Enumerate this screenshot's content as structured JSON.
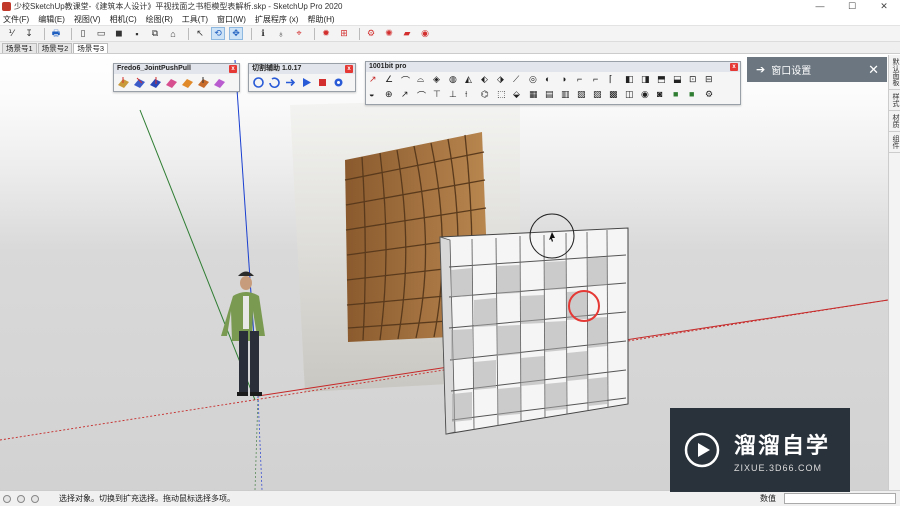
{
  "window": {
    "title": "少校SketchUp教课堂-《建筑本人设计》平视找面之书柜模型表解析.skp - SketchUp Pro 2020",
    "controls": [
      "—",
      "☐",
      "✕"
    ]
  },
  "menu": [
    "文件(F)",
    "编辑(E)",
    "视图(V)",
    "相机(C)",
    "绘图(R)",
    "工具(T)",
    "窗口(W)",
    "扩展程序 (x)",
    "帮助(H)"
  ],
  "scenes": [
    "场景号1",
    "场景号2",
    "场景号3"
  ],
  "floating_toolbars": {
    "fredo": {
      "title": "Fredo6_JointPushPull"
    },
    "cut": {
      "title": "切割辅助 1.0.17"
    },
    "bit": {
      "title": "1001bit pro"
    }
  },
  "panel": {
    "title": "窗口设置",
    "arrow": "➔",
    "close": "✕"
  },
  "right_tabs": [
    "默认面板",
    "样式",
    "材质",
    "组件"
  ],
  "status": {
    "message": "选择对象。切换到扩充选择。拖动鼠标选择多项。",
    "value_label": "数值",
    "value": ""
  },
  "watermark": {
    "brand": "溜溜自学",
    "url": "ZIXUE.3D66.COM"
  },
  "colors": {
    "axis_red": "#c62828",
    "axis_green": "#2e7d32",
    "axis_blue": "#1a3fd0",
    "panel_bg": "#6b7680"
  }
}
